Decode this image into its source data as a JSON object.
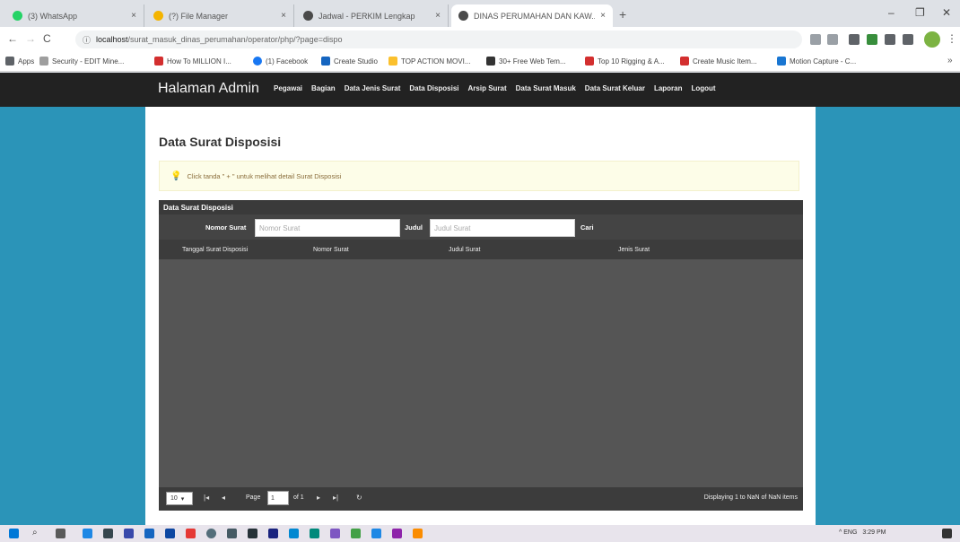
{
  "browser": {
    "tabs": [
      {
        "title": "(3) WhatsApp",
        "favicon_color": "#25d366"
      },
      {
        "title": "(?) File Manager",
        "favicon_color": "#f4b400"
      },
      {
        "title": "Jadwal - PERKIM Lengkap",
        "favicon_color": "#4a4a4a"
      },
      {
        "title": "DINAS PERUMAHAN DAN KAW...",
        "favicon_color": "#4a4a4a"
      }
    ],
    "new_tab": "+",
    "address": {
      "host": "localhost",
      "path": "/surat_masuk_dinas_perumahan/operator/php/?page=dispo"
    },
    "bookmarks": [
      {
        "label": "Apps",
        "icon_color": "#5f6368"
      },
      {
        "label": "Security - EDIT Mine...",
        "icon_color": "#9e9e9e"
      },
      {
        "label": "How To MILLION I...",
        "icon_color": "#d32f2f"
      },
      {
        "label": "(1) Facebook",
        "icon_color": "#1877f2"
      },
      {
        "label": "Create Studio",
        "icon_color": "#1565c0"
      },
      {
        "label": "TOP ACTION MOVI...",
        "icon_color": "#fbc02d"
      },
      {
        "label": "30+ Free Web Tem...",
        "icon_color": "#333333"
      },
      {
        "label": "Top 10 Rigging & A...",
        "icon_color": "#d32f2f"
      },
      {
        "label": "Create Music Item...",
        "icon_color": "#d32f2f"
      },
      {
        "label": "Motion Capture - C...",
        "icon_color": "#1976d2"
      }
    ],
    "nav": {
      "back": "←",
      "forward": "→",
      "reload": "C"
    }
  },
  "app": {
    "brand": "Halaman Admin",
    "nav": [
      "Pegawai",
      "Bagian",
      "Data Jenis Surat",
      "Data Disposisi",
      "Arsip Surat",
      "Data Surat Masuk",
      "Data Surat Keluar",
      "Laporan",
      "Logout"
    ],
    "page_title": "Data Surat Disposisi",
    "alert": "Click tanda \" + \" untuk melihat detail Surat Disposisi",
    "grid": {
      "title": "Data Surat Disposisi",
      "filter": {
        "nomor_label": "Nomor Surat",
        "nomor_placeholder": "Nomor Surat",
        "judul_label": "Judul",
        "judul_placeholder": "Judul Surat",
        "search_label": "Cari"
      },
      "columns": [
        "Tanggal Surat Disposisi",
        "Nomor Surat",
        "Judul Surat",
        "Jenis Surat"
      ],
      "pager": {
        "page_size": "10",
        "page_label": "Page",
        "page_value": "1",
        "of_label": "of 1",
        "info": "Displaying 1 to NaN of NaN items"
      }
    }
  },
  "taskbar": {
    "time": "3:29 PM",
    "tray": "^  ENG"
  }
}
